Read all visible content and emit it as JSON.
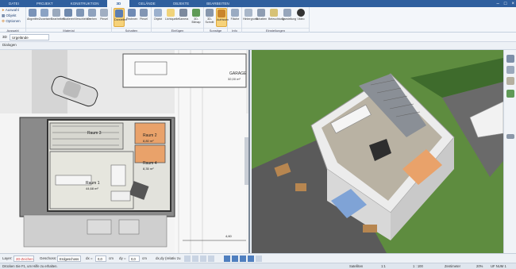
{
  "ribbon_tabs": [
    "Datei",
    "Projekt",
    "Konstruktion",
    "3D",
    "Gelände",
    "Objekte",
    "Bearbeiten"
  ],
  "active_tab": "3D",
  "ribbon_small": {
    "auswahl": "Auswahl",
    "objekt": "Objekt",
    "optionen": "Optionen"
  },
  "groups": {
    "auswahl": "Auswahl",
    "material": "Material",
    "schatten": "Schatten",
    "einfuegen": "Einfügen",
    "sonstige": "Sonstige",
    "info": "Info",
    "einstellungen": "Einstellungen"
  },
  "buttons": {
    "material": [
      "Abgreifen",
      "Zuweisen",
      "Bearbeiten",
      "Skalieren",
      "Verschieben",
      "Drehen",
      "Pinsel"
    ],
    "schatten": [
      "Darstellen",
      "Rechnen",
      "Pinsel"
    ],
    "einfuegen": [
      "Objekt",
      "Lichtquelle",
      "Kamera",
      "3D-Bilmap"
    ],
    "sonstige": [
      "3D-Schnitt",
      "Aufrissen"
    ],
    "info": [
      "Fläche"
    ],
    "einstellungen": [
      "Hintergrund",
      "Schatten",
      "Beleuchtung",
      "Darstellung",
      "Video"
    ]
  },
  "toolbar": {
    "view_select": "Urgelände"
  },
  "toolbar_3d_label": "3D",
  "subbar": {
    "label": "Dialogen"
  },
  "plan": {
    "garage_label": "GARAGE",
    "garage_area": "32,00 m²",
    "rooms": [
      {
        "name": "Raum 1",
        "area": "44,68 m²"
      },
      {
        "name": "Raum 2",
        "area": "8,80 m²"
      },
      {
        "name": "Raum 3",
        "area": ""
      },
      {
        "name": "Raum 4",
        "area": "8,35 m²"
      }
    ],
    "dim_bottom": "4,60"
  },
  "bottombar": {
    "layer_label": "Layer:",
    "layer_value": "2D-Zeichen",
    "geschoss_label": "Geschoss:",
    "geschoss_value": "Erdgeschoss",
    "dx_label": "dx =",
    "dx_value": "0,0",
    "dx_unit": "cm",
    "dy_label": "dy =",
    "dy_value": "0,0",
    "dy_unit": "cm",
    "relative_label": "dx,dy (relativ zu"
  },
  "status": {
    "hint": "Drücken Sie F1, um Hilfe zu erhalten.",
    "mode": "Satelliten",
    "scale_a": "1:1",
    "scale_b": "1 : 100",
    "unit": "Zentimeter",
    "zoom": "20%",
    "flags": "UF NUM 1"
  },
  "colors": {
    "ribbon_blue": "#2f5f9e",
    "active_button": "#f6d27a",
    "grass": "#4f7f3a",
    "room_orange": "#e9a26a"
  }
}
